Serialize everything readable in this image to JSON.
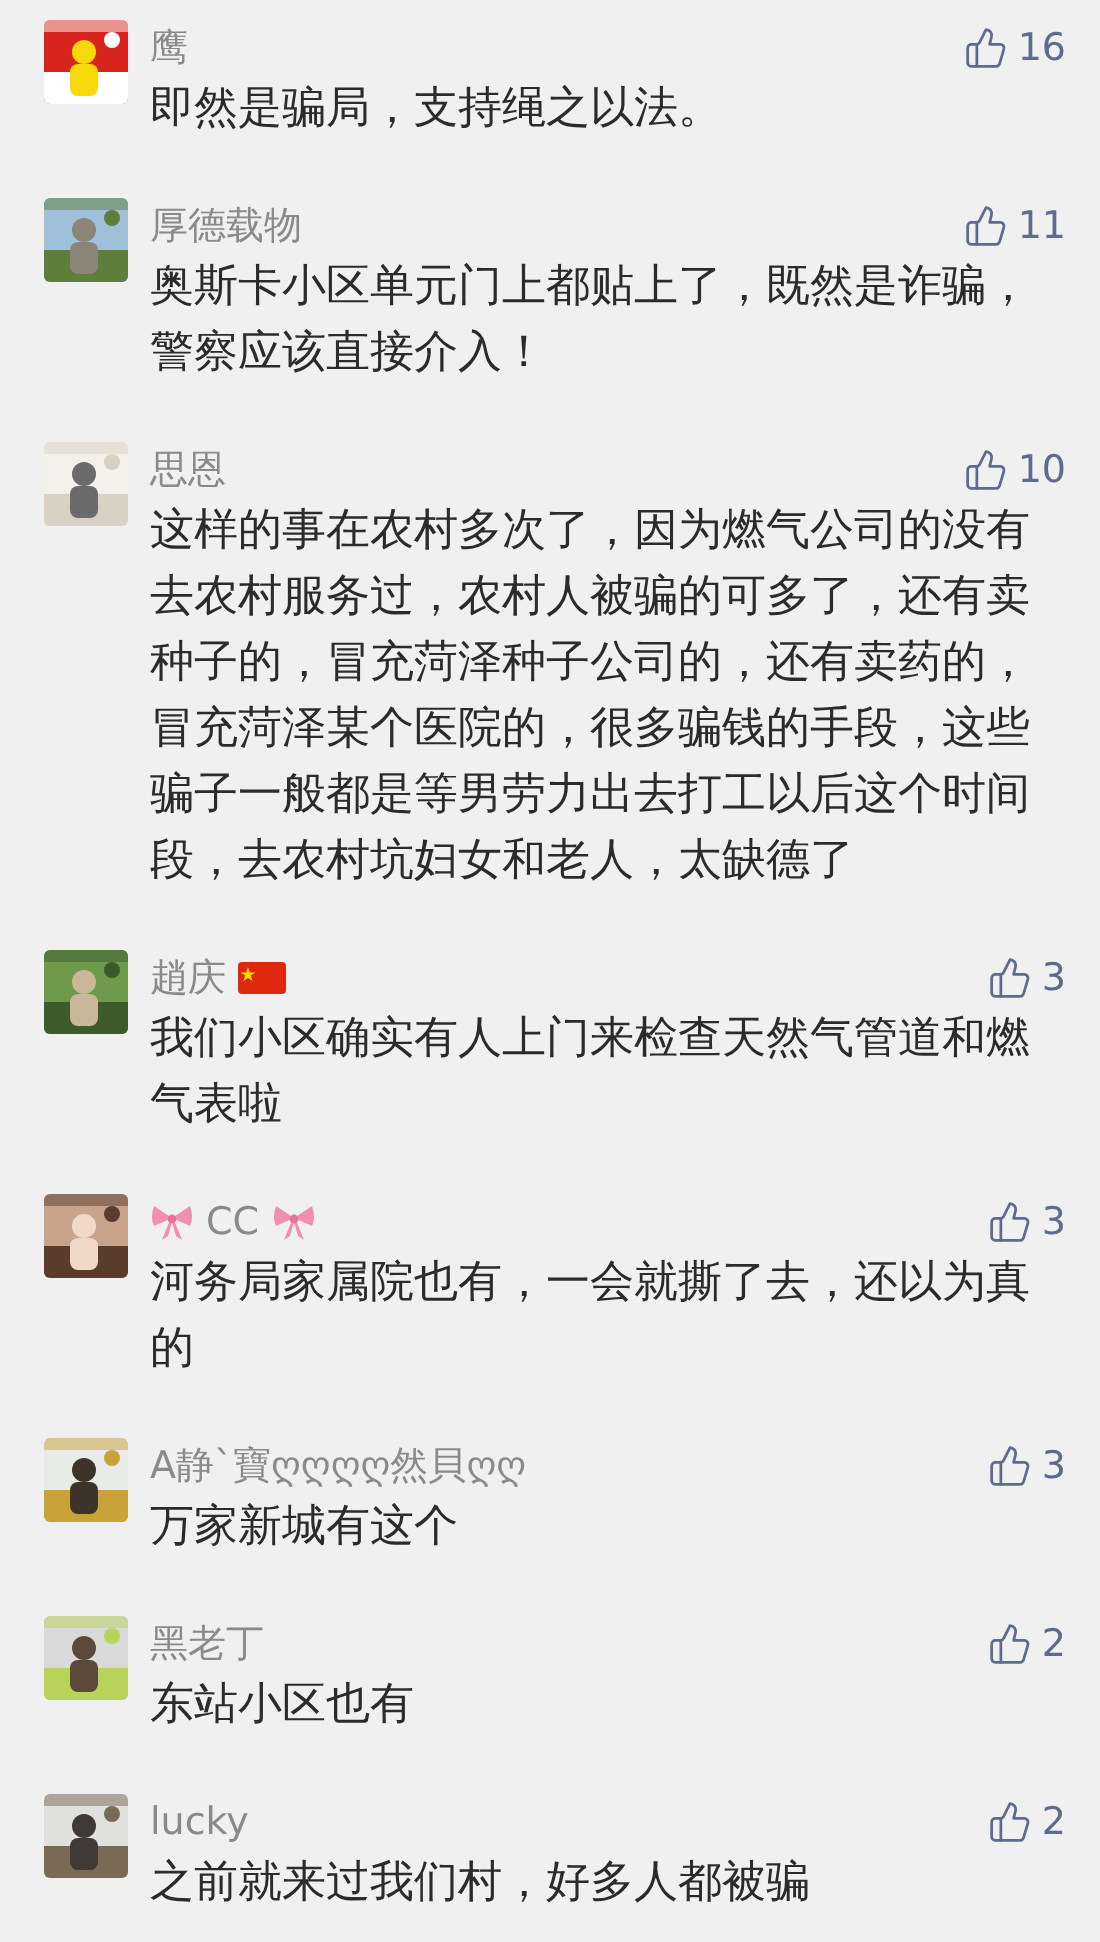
{
  "comments": [
    {
      "name": "鹰",
      "likes": "16",
      "text": "即然是骗局，支持绳之以法。"
    },
    {
      "name": "厚德载物",
      "likes": "11",
      "text": "奥斯卡小区单元门上都贴上了，既然是诈骗，警察应该直接介入！"
    },
    {
      "name": "思恩",
      "likes": "10",
      "text": "这样的事在农村多次了，因为燃气公司的没有去农村服务过，农村人被骗的可多了，还有卖种子的，冒充菏泽种子公司的，还有卖药的，冒充菏泽某个医院的，很多骗钱的手段，这些骗子一般都是等男劳力出去打工以后这个时间段，去农村坑妇女和老人，太缺德了"
    },
    {
      "name": "趙庆",
      "flag": true,
      "likes": "3",
      "text": "我们小区确实有人上门来检查天然气管道和燃气表啦"
    },
    {
      "name": "CC",
      "bows": true,
      "likes": "3",
      "text": "河务局家属院也有，一会就撕了去，还以为真的"
    },
    {
      "name": "A静`寶ღღღღ然貝ღღ",
      "likes": "3",
      "text": "万家新城有这个"
    },
    {
      "name": "黑老丁",
      "likes": "2",
      "text": "东站小区也有"
    },
    {
      "name": "lucky",
      "likes": "2",
      "text": "之前就来过我们村，好多人都被骗"
    }
  ]
}
